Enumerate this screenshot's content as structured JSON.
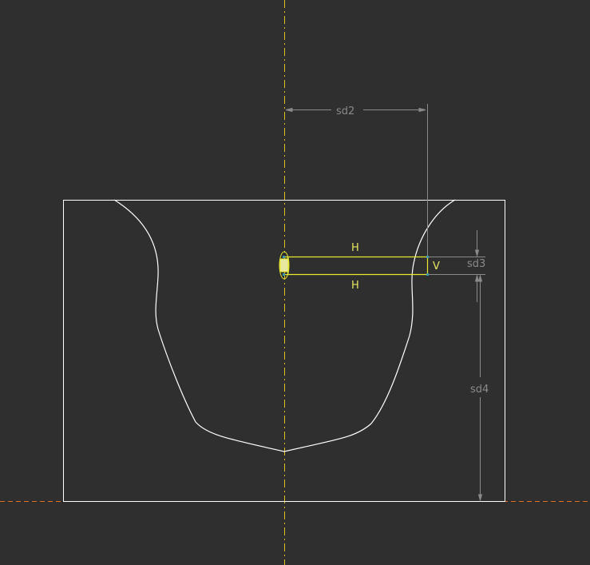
{
  "sketch": {
    "dimensions": {
      "horizontal": "sd2",
      "height": "sd3",
      "vertical": "sd4"
    },
    "constraints": {
      "top_line": "H",
      "bottom_line": "H",
      "right_line": "V"
    },
    "colors": {
      "background": "#2f2f2f",
      "geometry": "#ffffff",
      "selected": "#e8e830",
      "centerline": "#e0c020",
      "baseline": "#e07020",
      "dimension": "#8a8a8a",
      "vertex": "#3a9ab0"
    }
  }
}
